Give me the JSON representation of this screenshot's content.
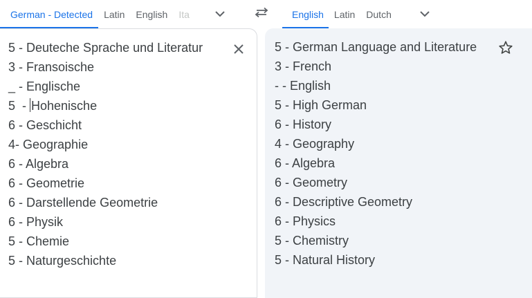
{
  "source_tabs": {
    "detected": "German - Detected",
    "latin": "Latin",
    "english": "English",
    "partial": "Ita"
  },
  "target_tabs": {
    "english": "English",
    "latin": "Latin",
    "dutch": "Dutch"
  },
  "source_lines": [
    "5 - Deuteche Sprache und Literatur",
    "3 - Fransoische",
    "_ - Englische",
    "Hohenische",
    "6 - Geschicht",
    "4- Geographie",
    "6 - Algebra",
    "6 - Geometrie",
    "6 - Darstellende Geometrie",
    "6 - Physik",
    "5 - Chemie",
    "5 - Naturgeschichte"
  ],
  "source_line_4_prefix": "5  - ",
  "target_lines": [
    "5 - German Language and Literature",
    "3 - French",
    "- - English",
    "5 - High German",
    "6 - History",
    "4 - Geography",
    "6 - Algebra",
    "6 - Geometry",
    "6 - Descriptive Geometry",
    "6 - Physics",
    "5 - Chemistry",
    "5 - Natural History"
  ],
  "icons": {
    "dropdown": "chevron-down-icon",
    "swap": "swap-icon",
    "clear": "close-icon",
    "save": "star-outline-icon"
  },
  "colors": {
    "accent": "#1a73e8",
    "text": "#3c4043",
    "output_bg": "#f1f4f8"
  }
}
